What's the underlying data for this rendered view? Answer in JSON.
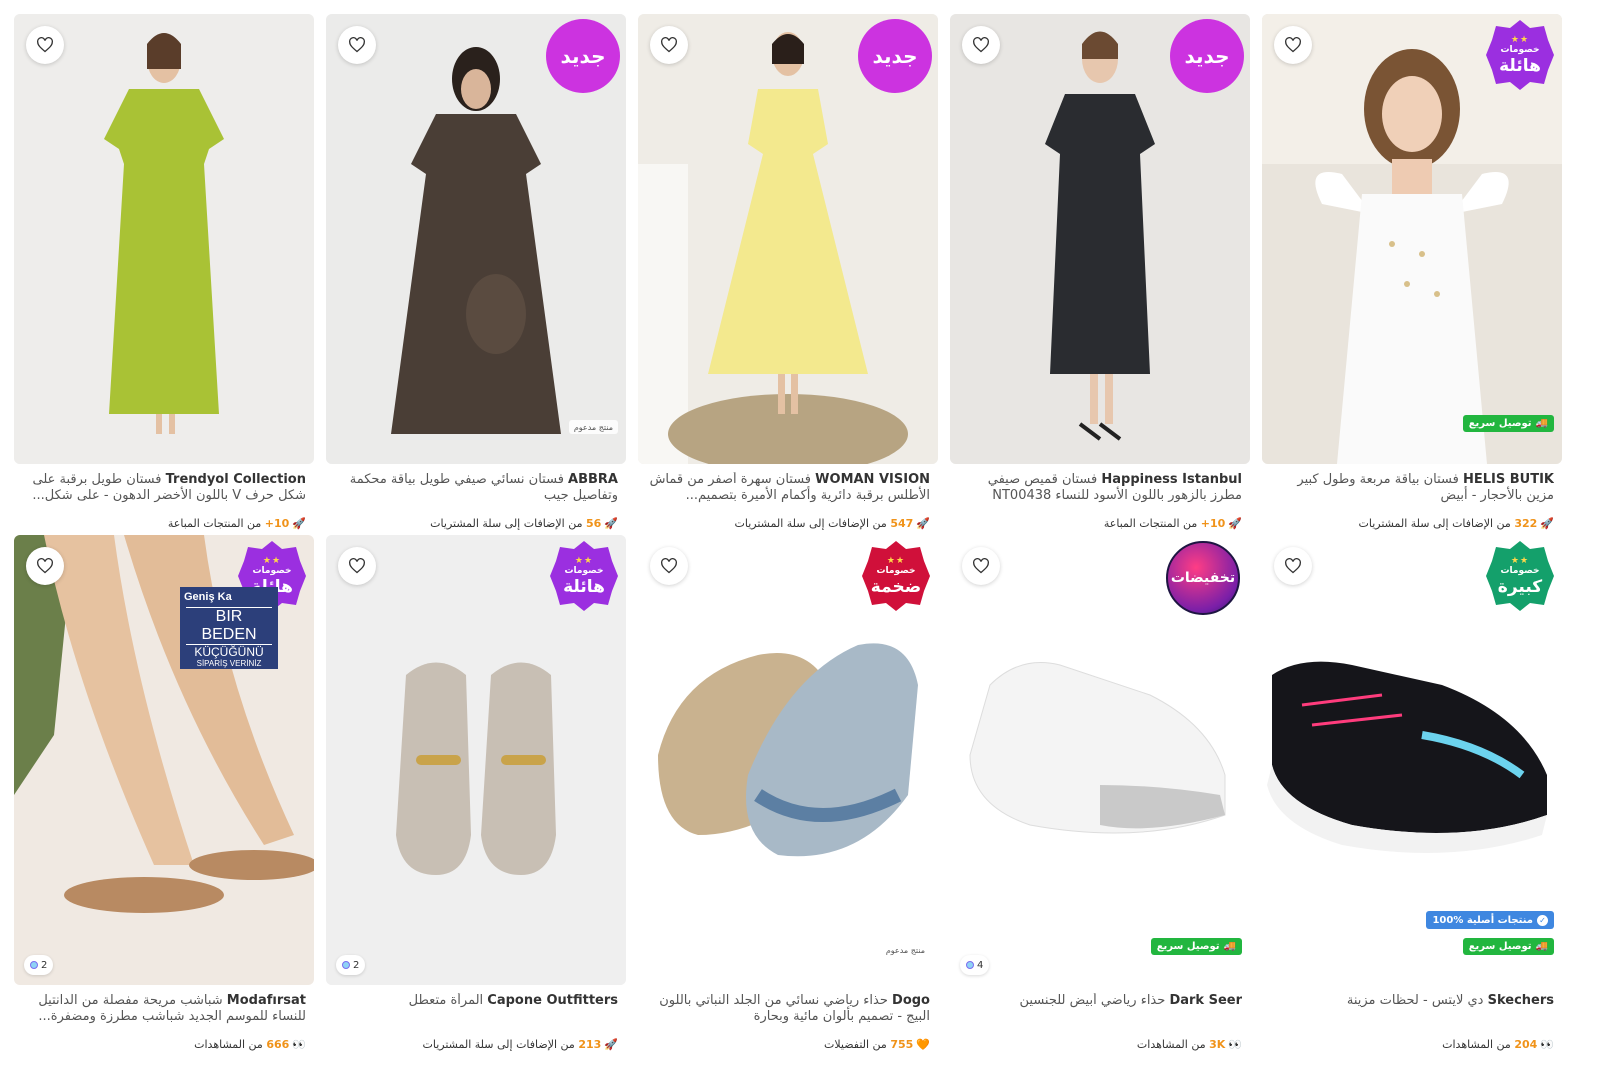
{
  "products": [
    {
      "brand": "HELİS BUTİK",
      "name": "فستان بياقة مربعة وطول كبير مزين بالأحجار - أبيض",
      "meta_value": "322",
      "meta_text": "من الإضافات إلى سلة المشتريات",
      "meta_icon": "rocket-icon",
      "badge_type": "deal",
      "badge_l1": "خصومات",
      "badge_l2": "هائلة",
      "badge_color": "#9b2fe0",
      "fast_delivery": "توصيل سريع",
      "photo": "dress-white"
    },
    {
      "brand": "Happiness İstanbul",
      "name": "فستان قميص صيفي مطرز بالزهور باللون الأسود للنساء NT00438",
      "meta_value": "10+",
      "meta_text": "من المنتجات المباعة",
      "meta_icon": "rocket-icon",
      "badge_type": "new",
      "badge_text": "جديد",
      "photo": "dress-black"
    },
    {
      "brand": "WOMAN VISION",
      "name": "فستان سهرة أصفر من قماش الأطلس برقبة دائرية وأكمام الأميرة بتصميم...",
      "meta_value": "547",
      "meta_text": "من الإضافات إلى سلة المشتريات",
      "meta_icon": "rocket-icon",
      "badge_type": "new",
      "badge_text": "جديد",
      "photo": "dress-yellow"
    },
    {
      "brand": "ABBRA",
      "name": "فستان نسائي صيفي طويل بياقة محكمة وتفاصيل جيب",
      "meta_value": "56",
      "meta_text": "من الإضافات إلى سلة المشتريات",
      "meta_icon": "rocket-icon",
      "badge_type": "new",
      "badge_text": "جديد",
      "sponsored": "منتج مدعوم",
      "photo": "dress-brown"
    },
    {
      "brand": "Trendyol Collection",
      "name": "فستان طويل برقبة على شكل حرف V باللون الأخضر الدهون - على شكل...",
      "meta_value": "10+",
      "meta_text": "من المنتجات المباعة",
      "meta_icon": "rocket-icon",
      "photo": "dress-green"
    },
    {
      "brand": "Skechers",
      "name": "دي لايتس - لحظات مزينة",
      "meta_value": "204",
      "meta_text": "من المشاهدات",
      "meta_icon": "eyes-icon",
      "badge_type": "deal",
      "badge_l1": "خصومات",
      "badge_l2": "كبيرة",
      "badge_color": "#14a06b",
      "fast_delivery": "توصيل سريع",
      "original": "منتجات أصلية %100",
      "photo": "shoe-skechers"
    },
    {
      "brand": "Dark Seer",
      "name": "حذاء رياضي أبيض للجنسين",
      "meta_value": "3K",
      "meta_text": "من المشاهدات",
      "meta_icon": "eyes-icon",
      "badge_type": "sale",
      "badge_text": "تخفيضات",
      "fast_delivery": "توصيل سريع",
      "colors": "4",
      "photo": "shoe-white"
    },
    {
      "brand": "Dogo",
      "name": "حذاء رياضي نسائي من الجلد النباتي باللون البيج - تصميم بألوان مائية وبحارة",
      "meta_value": "755",
      "meta_text": "من التفضيلات",
      "meta_icon": "heart-icon",
      "badge_type": "deal",
      "badge_l1": "خصومات",
      "badge_l2": "ضخمة",
      "badge_color": "#d0103a",
      "sponsored": "منتج مدعوم",
      "photo": "shoe-dogo"
    },
    {
      "brand": "Capone Outfitters",
      "name": "المرأة متعطل",
      "meta_value": "213",
      "meta_text": "من الإضافات إلى سلة المشتريات",
      "meta_icon": "rocket-icon",
      "badge_type": "deal",
      "badge_l1": "خصومات",
      "badge_l2": "هائلة",
      "badge_color": "#9b2fe0",
      "colors": "2",
      "photo": "shoe-loafer"
    },
    {
      "brand": "Modafırsat",
      "name": "شباشب مريحة مفصلة من الدانتيل للنساء للموسم الجديد شباشب مطرزة ومضفرة...",
      "meta_value": "666",
      "meta_text": "من المشاهدات",
      "meta_icon": "eyes-icon",
      "badge_type": "deal",
      "badge_l1": "خصومات",
      "badge_l2": "هائلة",
      "badge_color": "#9b2fe0",
      "colors": "2",
      "banner_l1": "Geniş Ka",
      "banner_l2": "BIR BEDEN",
      "banner_l3": "KÜÇÜĞÜNÜ",
      "banner_l4": "SİPARİŞ VERİNİZ",
      "photo": "sandal"
    }
  ]
}
